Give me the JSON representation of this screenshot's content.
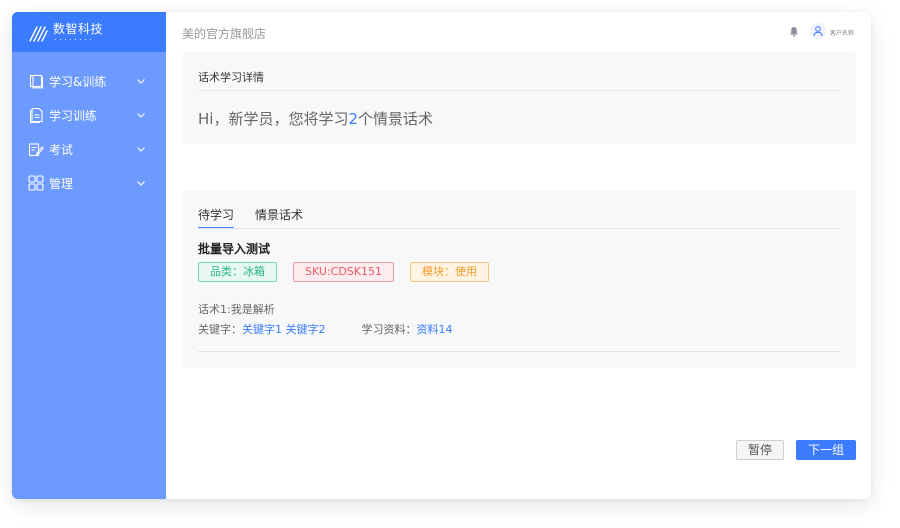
{
  "brand": {
    "name": "数智科技",
    "icon": "brand-logo-icon"
  },
  "sidebar": {
    "items": [
      {
        "label": "学习&训练",
        "icon": "book-icon"
      },
      {
        "label": "学习训练",
        "icon": "document-icon"
      },
      {
        "label": "考试",
        "icon": "exam-icon"
      },
      {
        "label": "管理",
        "icon": "grid-icon"
      }
    ]
  },
  "header": {
    "store_name": "美的官方旗舰店",
    "client_name": "客户名称"
  },
  "detail": {
    "title": "话术学习详情",
    "greeting_prefix": "Hi，新学员，您将学习",
    "greeting_count": "2",
    "greeting_suffix": "个情景话术"
  },
  "tabs": [
    {
      "label": "待学习",
      "active": true
    },
    {
      "label": "情景话术",
      "active": false
    }
  ],
  "item": {
    "title": "批量导入测试",
    "tags": [
      {
        "text": "品类：冰箱",
        "color": "#2bb68a"
      },
      {
        "text": "SKU:CDSK151",
        "color": "#e85a6a"
      },
      {
        "text": "模块：使用",
        "color": "#f39c2b"
      }
    ],
    "analysis": "话术1:我是解析",
    "keywords_label": "关键字：",
    "keywords": [
      "关键字1",
      "关键字2"
    ],
    "materials_label": "学习资料：",
    "materials": "资料14"
  },
  "actions": {
    "pause_label": "暂停",
    "next_label": "下一组"
  },
  "colors": {
    "primary": "#3b7bff",
    "sidebar": "#6d9afe"
  }
}
